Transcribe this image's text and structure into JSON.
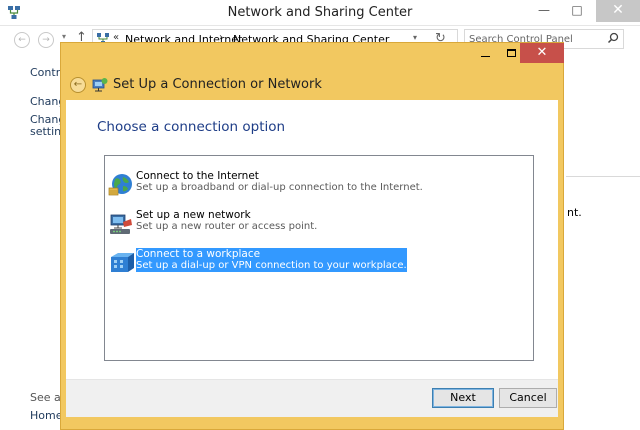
{
  "background_window": {
    "title": "Network and Sharing Center",
    "minimize_glyph": "—",
    "maximize_glyph": "□",
    "close_glyph": "✕",
    "back_glyph": "←",
    "forward_glyph": "→",
    "dropdown_glyph": "▾",
    "up_glyph": "↑",
    "address": {
      "separator_root": "«",
      "crumbs": [
        "Network and Internet",
        "Network and Sharing Center"
      ],
      "separator": "›",
      "refresh_glyph": "↻"
    },
    "search": {
      "placeholder": "Search Control Panel"
    },
    "left_pane": {
      "link1": "Control",
      "link2": "Change",
      "link3": "Change",
      "link3b": "settings",
      "see_also": "See also",
      "homegroup": "HomeG"
    },
    "right_text": "nt."
  },
  "dialog": {
    "title": "Set Up a Connection or Network",
    "back_glyph": "←",
    "close_glyph": "✕",
    "heading": "Choose a connection option",
    "options": [
      {
        "title": "Connect to the Internet",
        "description": "Set up a broadband or dial-up connection to the Internet.",
        "icon": "globe-icon",
        "selected": false
      },
      {
        "title": "Set up a new network",
        "description": "Set up a new router or access point.",
        "icon": "router-icon",
        "selected": false
      },
      {
        "title": "Connect to a workplace",
        "description": "Set up a dial-up or VPN connection to your workplace.",
        "icon": "workplace-icon",
        "selected": true
      }
    ],
    "buttons": {
      "next": "Next",
      "cancel": "Cancel"
    }
  },
  "colors": {
    "dialog_frame": "#f2c860",
    "selection": "#3399ff",
    "heading": "#1e3d87",
    "close_button": "#c7504a"
  }
}
